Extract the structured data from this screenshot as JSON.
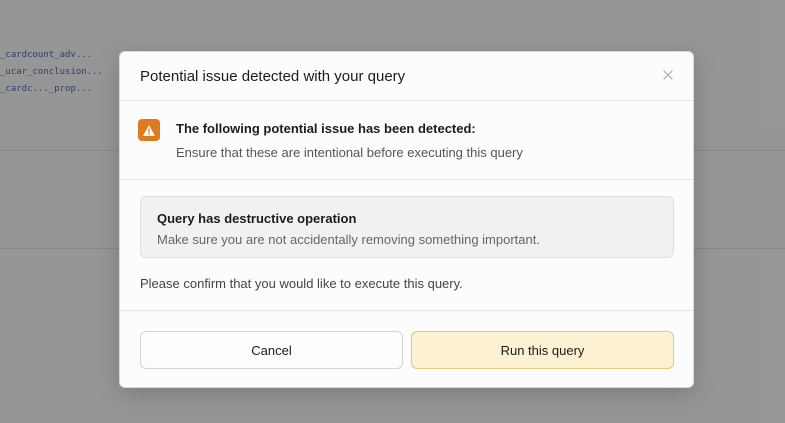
{
  "background": {
    "code_lines": [
      "_cardcount_adv...",
      "_ucar_conclusion...",
      "_cardc..._prop..."
    ]
  },
  "dialog": {
    "title": "Potential issue detected with your query",
    "close_icon": "close-icon",
    "issue": {
      "icon": "warning-icon",
      "heading": "The following potential issue has been detected:",
      "description": "Ensure that these are intentional before executing this query"
    },
    "alert": {
      "title": "Query has destructive operation",
      "description": "Make sure you are not accidentally removing something important."
    },
    "confirm_text": "Please confirm that you would like to execute this query.",
    "buttons": {
      "cancel": "Cancel",
      "run": "Run this query"
    }
  },
  "colors": {
    "warning": "#e07a1f",
    "run_button_bg": "#fdf1d3",
    "run_button_border": "#e6c97a"
  }
}
